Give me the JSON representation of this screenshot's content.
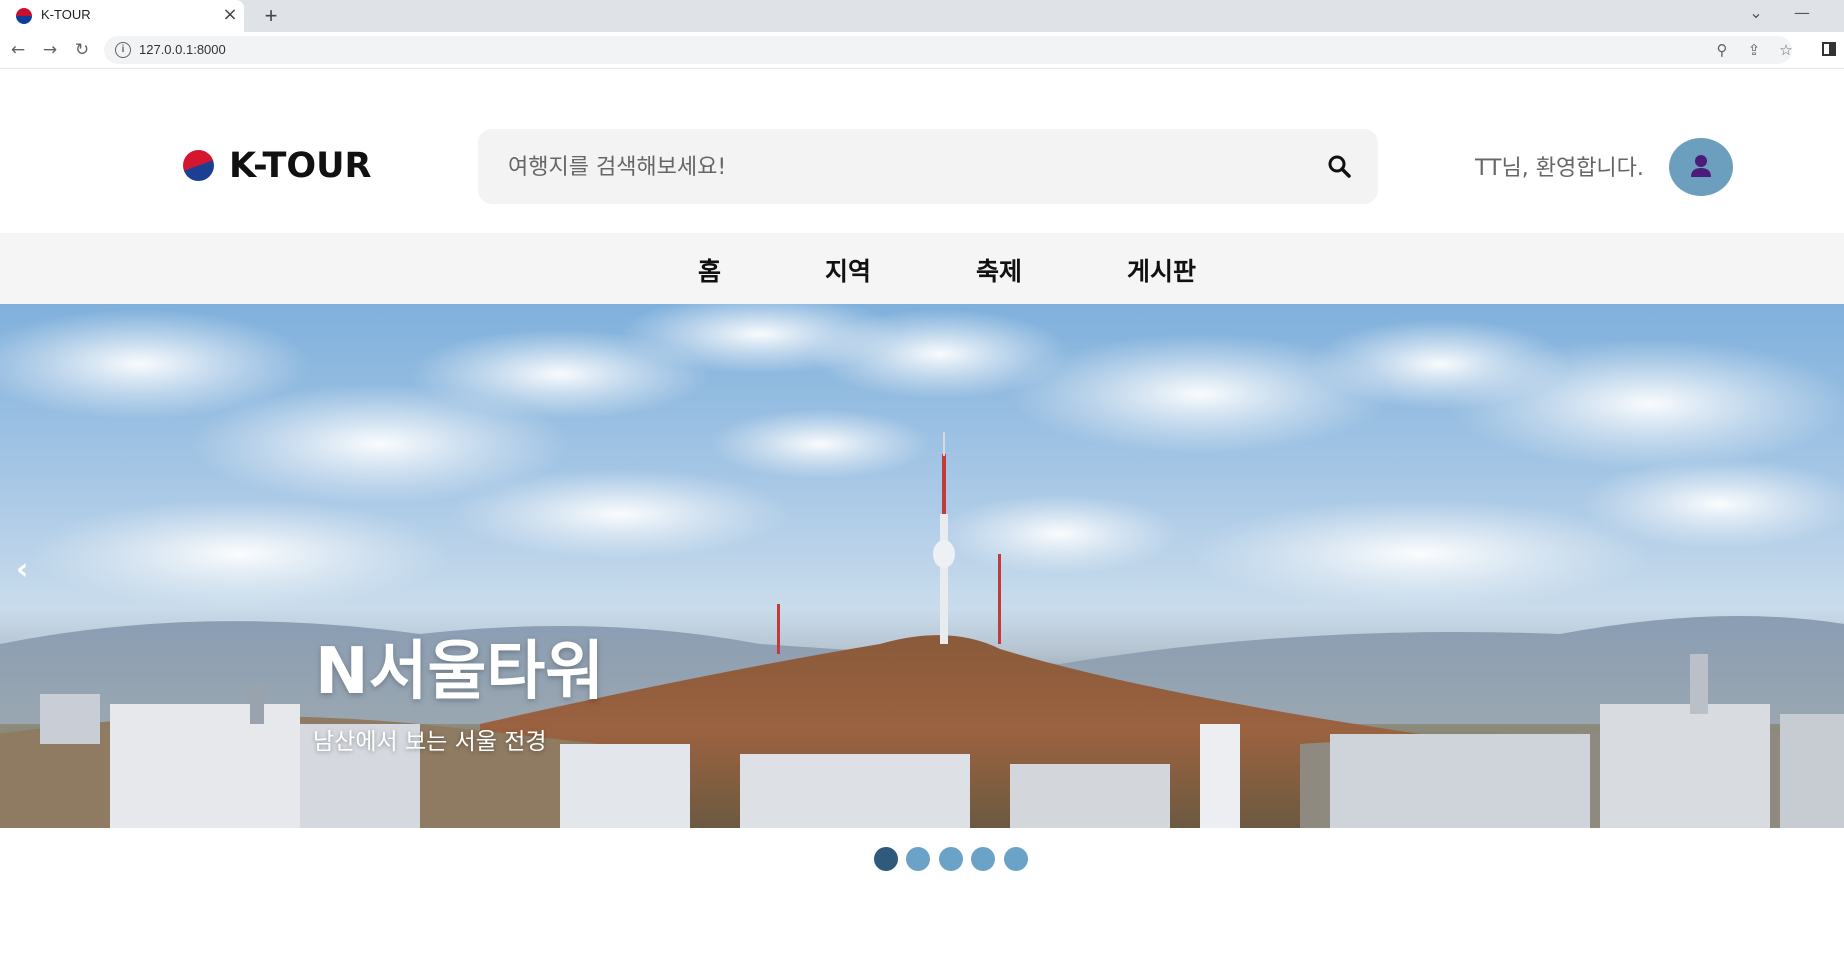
{
  "browser": {
    "tab_title": "K-TOUR",
    "tab_close": "×",
    "new_tab": "+",
    "url": "127.0.0.1:8000",
    "window_controls": {
      "dropdown": "⌄",
      "minimize": "—",
      "maximize": "□"
    }
  },
  "header": {
    "logo_text": "K-TOUR",
    "search_placeholder": "여행지를 검색해보세요!",
    "welcome_text": "TT님, 환영합니다."
  },
  "nav": {
    "items": [
      "홈",
      "지역",
      "축제",
      "게시판"
    ]
  },
  "hero": {
    "prev_arrow": "‹",
    "title": "N서울타워",
    "subtitle": "남산에서 보는 서울 전경"
  },
  "carousel": {
    "slide_count": 5,
    "active_index": 0
  },
  "colors": {
    "accent": "#6c9fbe",
    "dot_active": "#2f5a7b",
    "dot_inactive": "#6aa3c7",
    "avatar_icon": "#4b1c7a"
  },
  "icons": {
    "search": "search-icon",
    "user": "user-icon",
    "back": "back-arrow-icon",
    "forward": "forward-arrow-icon",
    "reload": "reload-icon",
    "info": "info-icon",
    "zoom": "zoom-icon",
    "share": "share-icon",
    "bookmark": "star-icon",
    "side_panel": "side-panel-icon"
  }
}
